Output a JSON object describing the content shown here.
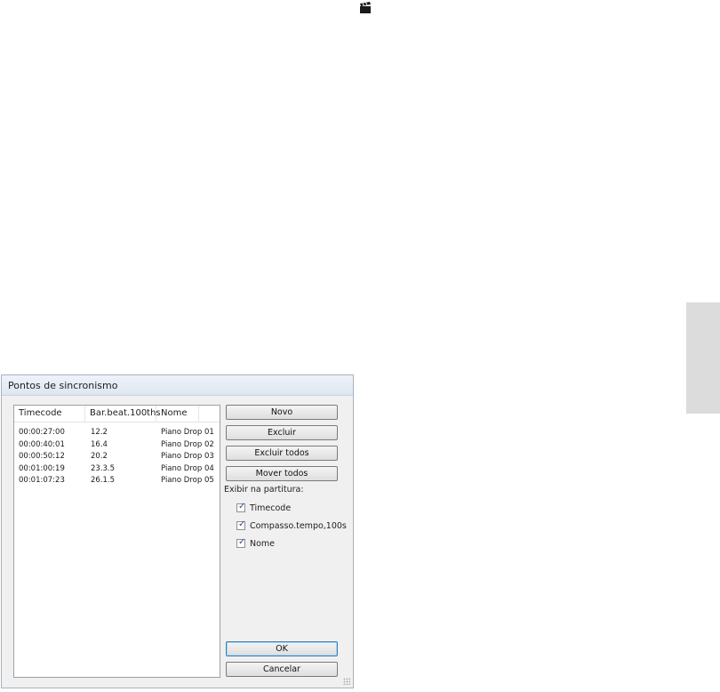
{
  "icons": {
    "top_icon": "clapperboard-icon"
  },
  "dialog": {
    "title": "Pontos de sincronismo",
    "list": {
      "columns": [
        "Timecode",
        "Bar.beat.100ths",
        "Nome"
      ],
      "sort_indicator": "ˆ",
      "rows": [
        {
          "timecode": "00:00:27:00",
          "bar_beat": "12.2",
          "name": "Piano Drop 01"
        },
        {
          "timecode": "00:00:40:01",
          "bar_beat": "16.4",
          "name": "Piano Drop 02"
        },
        {
          "timecode": "00:00:50:12",
          "bar_beat": "20.2",
          "name": "Piano Drop 03"
        },
        {
          "timecode": "00:01:00:19",
          "bar_beat": "23.3.5",
          "name": "Piano Drop 04"
        },
        {
          "timecode": "00:01:07:23",
          "bar_beat": "26.1.5",
          "name": "Piano Drop 05"
        }
      ]
    },
    "buttons": {
      "novo": "Novo",
      "excluir": "Excluir",
      "excluir_todos": "Excluir todos",
      "mover_todos": "Mover todos",
      "ok": "OK",
      "cancelar": "Cancelar"
    },
    "display_group": {
      "label": "Exibir na partitura:",
      "options": [
        {
          "label": "Timecode",
          "checked": true
        },
        {
          "label": "Compasso.tempo,100s",
          "checked": true
        },
        {
          "label": "Nome",
          "checked": true
        }
      ]
    }
  },
  "colors": {
    "dialog_bg": "#f0f0f0",
    "side_tab": "#dcdcdc",
    "default_button_border": "#3c7fb1"
  }
}
